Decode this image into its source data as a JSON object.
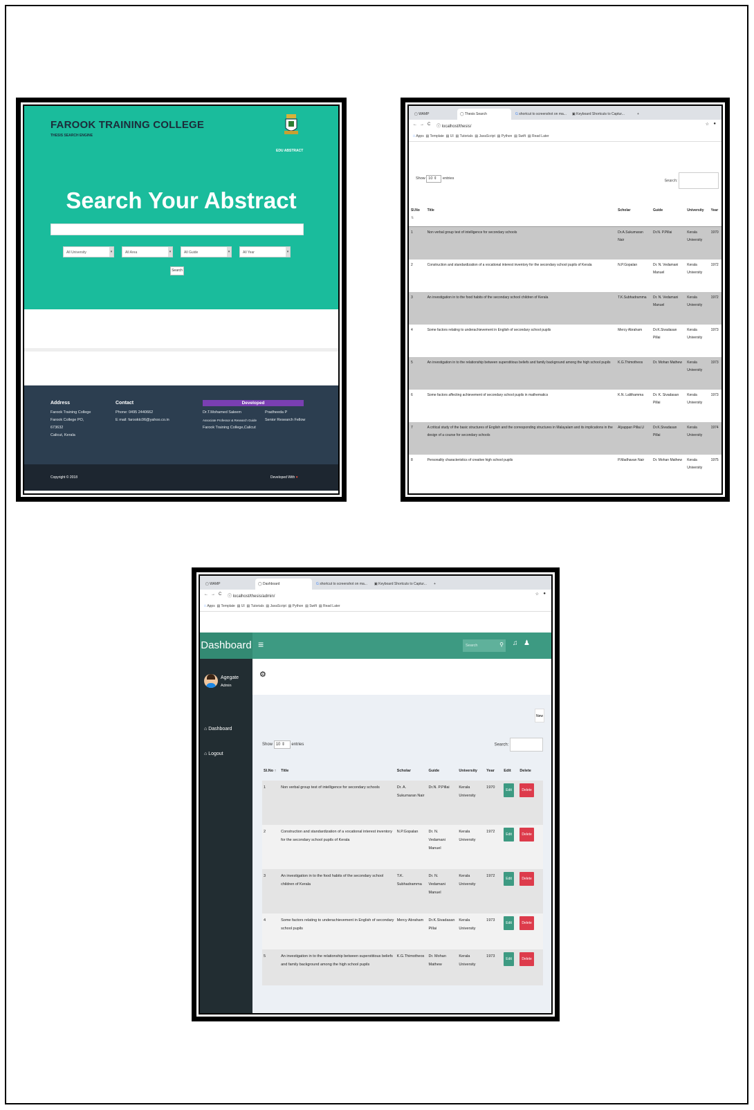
{
  "shot1": {
    "brand": "FAROOK TRAINING COLLEGE",
    "brand_sub": "THESIS SEARCH ENGINE",
    "edu": "EDU ABSTRACT",
    "hero_title": "Search Your Abstract",
    "filters": [
      "All University",
      "All Area",
      "All Guide",
      "All Year"
    ],
    "search_button": "Search",
    "footer": {
      "address_heading": "Address",
      "address_lines": [
        "Farook Training College",
        "Farook College PO,",
        "673632",
        "Calicut, Kerala"
      ],
      "contact_heading": "Contact",
      "contact_lines": [
        "Phone: 0495 2440662",
        "E mail: farooktc06@yahoo.co.in"
      ],
      "developed_heading": "Developed",
      "developer1": [
        "Dr.T.Mohamed Saleem",
        "Associate Professor & Research Guide",
        "Farook Training College,Calicut"
      ],
      "developer2": [
        "Pradheeda P",
        "Senior Research Fellow"
      ],
      "copyright": "Copyright © 2018",
      "developed_with": "Developed With"
    },
    "colors": {
      "teal": "#1abc9c",
      "navy": "#2c3e50",
      "purple": "#7a3fb2"
    }
  },
  "browser": {
    "tabs": [
      "WAMP",
      "Thesis Search",
      "shortcut to screenshot on ma...",
      "Keyboard Shortcuts to Captur..."
    ],
    "tabs_admin": [
      "WAMP",
      "Dashboard",
      "shortcut to screenshot on ma...",
      "Keyboard Shortcuts to Captur..."
    ],
    "url": "localhost/thesis/",
    "url_admin": "localhost/thesis/admin/",
    "bookmarks": [
      "Apps",
      "Template",
      "UI",
      "Tutorials",
      "JavaScript",
      "Python",
      "Swift",
      "Read Later"
    ]
  },
  "shot2": {
    "show": "Show",
    "entries_value": "10",
    "entries": "entries",
    "search_label": "Search:",
    "headers": [
      "Sl.No",
      "Title",
      "Scholar",
      "Guide",
      "University",
      "Year"
    ],
    "rows": [
      [
        "1",
        "Non verbal group test of intelligence for secondary schools",
        "Dr.A.Sukumaran Nair",
        "Dr.N. P.Pillai",
        "Kerala University",
        "1970"
      ],
      [
        "2",
        "Construction and standardization of a vocational interest inventory for the secondary school pupils of Kerala",
        "N.P.Gopalan",
        "Dr. N. Vedamani Manuel",
        "Kerala University",
        "1972"
      ],
      [
        "3",
        "An investigation in to the food habits of the secondary school children of Kerala",
        "T.K.Subhadramma",
        "Dr. N. Vedamani Manuel",
        "Kerala University",
        "1972"
      ],
      [
        "4",
        "Some factors relating to underachievement in English of secondary school pupils",
        "Mercy Abraham",
        "Dr.K.Sivadasan Pillai",
        "Kerala University",
        "1973"
      ],
      [
        "5",
        "An investigation in to the relationship between superstitious beliefs and family background among the high school pupils",
        "K.G.Thimotheos",
        "Dr. Mohan Mathew",
        "Kerala University",
        "1973"
      ],
      [
        "6",
        "Some factors affecting achievement of secondary school pupils in mathematics",
        "K.N. Lalithamma",
        "Dr. K. Sivadasan Pillai",
        "Kerala University",
        "1973"
      ],
      [
        "7",
        "A critical study of the basic structures of English and the corresponding structures in Malayalam and its implications in the design of a course for secondary schools",
        "Alyappan Pillai.U",
        "Dr.K.Sivadasan Pillai",
        "Kerala University",
        "1974"
      ],
      [
        "8",
        "Personality characteristics of creative high school pupils",
        "P.Madhavan Nair",
        "Dr. Mohan Mathew",
        "Kerala University",
        "1975"
      ]
    ]
  },
  "shot3": {
    "logo": "Dashboard",
    "search_placeholder": "Search",
    "user_name": "Agegate",
    "user_role": "Admin",
    "menu": [
      "Dashboard",
      "Logout"
    ],
    "new_button": "New",
    "show": "Show",
    "entries_value": "10",
    "entries": "entries",
    "search_label": "Search:",
    "headers": [
      "Sl.No",
      "Title",
      "Scholar",
      "Guide",
      "University",
      "Year",
      "Edit",
      "Delete"
    ],
    "edit_label": "Edit",
    "delete_label": "Delete",
    "rows": [
      [
        "1",
        "Non verbal group test of intelligence for secondary schools",
        "Dr. A. Sukumaran Nair",
        "Dr.N. P.Pillai",
        "Kerala University",
        "1970"
      ],
      [
        "2",
        "Construction and standardization of a vocational interest inventory for the secondary school pupils of Kerala",
        "N.P.Gopalan",
        "Dr. N. Vedamani Manuel",
        "Kerala University",
        "1972"
      ],
      [
        "3",
        "An investigation in to the food habits of the secondary school children of Kerala",
        "T.K. Subhadramma",
        "Dr. N. Vedamani Manuel",
        "Kerala University",
        "1972"
      ],
      [
        "4",
        "Some factors relating to underachievement in English of secondary school pupils",
        "Mercy Abraham",
        "Dr.K.Sivadasan Pillai",
        "Kerala University",
        "1973"
      ],
      [
        "5",
        "An investigation in to the relationship between superstitious beliefs and family background among the high school pupils",
        "K.G.Thimotheos",
        "Dr. Mohan Mathew",
        "Kerala University",
        "1973"
      ]
    ],
    "colors": {
      "header": "#3d9a82",
      "sidebar": "#222d32",
      "delete": "#dd3b4b"
    }
  }
}
